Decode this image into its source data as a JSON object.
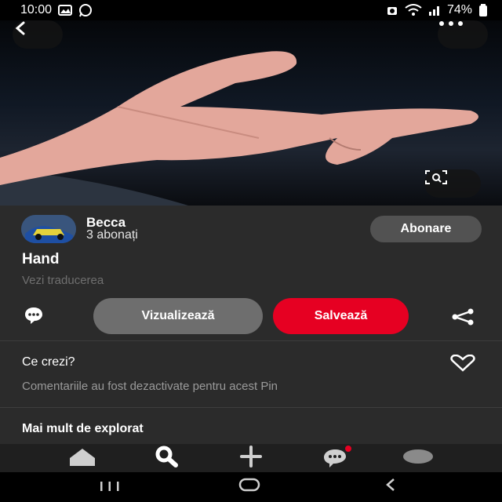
{
  "status_bar": {
    "time": "10:00",
    "battery": "74%",
    "left_icons": [
      "image-icon",
      "whatsapp-icon"
    ],
    "right_icons": [
      "alarm-icon",
      "wifi-icon",
      "signal-icon",
      "battery-icon"
    ]
  },
  "photo": {
    "icons": [
      "back-icon",
      "more-options-icon",
      "visual-search-icon"
    ]
  },
  "creator": {
    "name": "Becca",
    "subscribers": "3 abonați",
    "follow_label": "Abonare"
  },
  "pin": {
    "title": "Hand",
    "translate_label": "Vezi traducerea"
  },
  "actions": {
    "view_label": "Vizualizează",
    "save_label": "Salvează",
    "icons": [
      "comment-icon",
      "share-icon"
    ]
  },
  "comments": {
    "heading": "Ce crezi?",
    "disabled_text": "Comentariile au fost dezactivate pentru acest Pin",
    "icon": "heart-icon"
  },
  "explore": {
    "heading": "Mai mult de explorat"
  },
  "tab_bar": {
    "tabs": [
      "home-icon",
      "search-icon",
      "create-icon",
      "messages-icon",
      "profile-icon"
    ],
    "active": "search-icon"
  },
  "navigation": {
    "buttons": [
      "recent-apps-icon",
      "home-button-icon",
      "back-icon"
    ]
  },
  "colors": {
    "save_button": "#e60022",
    "panel_background": "#2b2b2b",
    "tab_bar_background": "#1f1f1f"
  }
}
